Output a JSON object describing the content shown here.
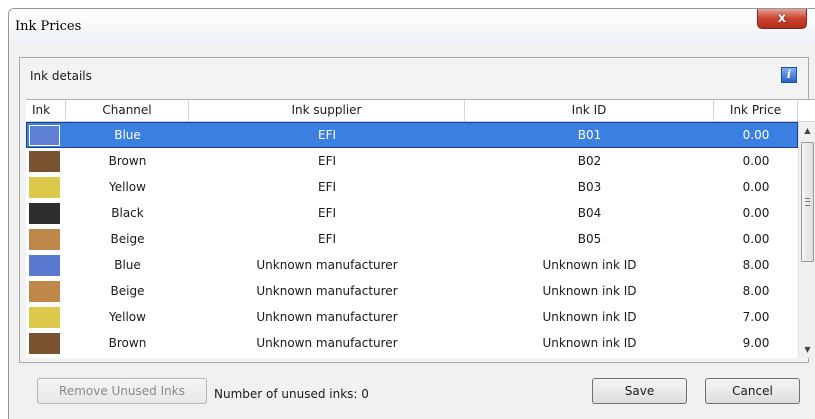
{
  "window": {
    "title": "Ink Prices",
    "close_glyph": "x"
  },
  "panel": {
    "title": "Ink details",
    "info_glyph": "i"
  },
  "table": {
    "columns": [
      "Ink",
      "Channel",
      "Ink supplier",
      "Ink ID",
      "Ink Price"
    ],
    "rows": [
      {
        "color": "#5d7fd4",
        "channel": "Blue",
        "supplier": "EFI",
        "ink_id": "B01",
        "price": "0.00",
        "selected": true
      },
      {
        "color": "#7a5430",
        "channel": "Brown",
        "supplier": "EFI",
        "ink_id": "B02",
        "price": "0.00"
      },
      {
        "color": "#dcc84a",
        "channel": "Yellow",
        "supplier": "EFI",
        "ink_id": "B03",
        "price": "0.00"
      },
      {
        "color": "#2e2e2e",
        "channel": "Black",
        "supplier": "EFI",
        "ink_id": "B04",
        "price": "0.00"
      },
      {
        "color": "#c0874a",
        "channel": "Beige",
        "supplier": "EFI",
        "ink_id": "B05",
        "price": "0.00"
      },
      {
        "color": "#5a78d0",
        "channel": "Blue",
        "supplier": "Unknown manufacturer",
        "ink_id": "Unknown ink ID",
        "price": "8.00"
      },
      {
        "color": "#c0874a",
        "channel": "Beige",
        "supplier": "Unknown manufacturer",
        "ink_id": "Unknown ink ID",
        "price": "8.00"
      },
      {
        "color": "#dcc84a",
        "channel": "Yellow",
        "supplier": "Unknown manufacturer",
        "ink_id": "Unknown ink ID",
        "price": "7.00"
      },
      {
        "color": "#7a5430",
        "channel": "Brown",
        "supplier": "Unknown manufacturer",
        "ink_id": "Unknown ink ID",
        "price": "9.00"
      }
    ]
  },
  "footer": {
    "remove_unused_label": "Remove Unused Inks",
    "unused_count_text": "Number of unused inks: 0",
    "save_label": "Save",
    "cancel_label": "Cancel"
  },
  "colors": {
    "selection": "#3b7fe0",
    "close_button": "#c8432f",
    "info_icon": "#2a62c8"
  }
}
